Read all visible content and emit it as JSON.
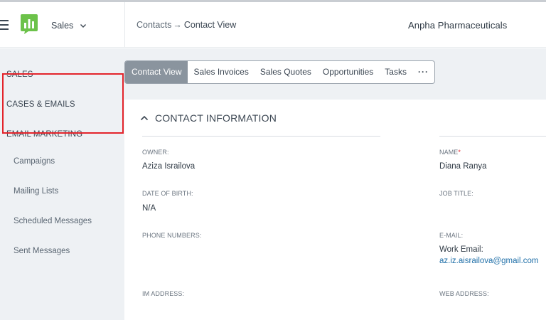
{
  "header": {
    "app_name": "Sales",
    "breadcrumb": {
      "parent": "Contacts",
      "arrow": "→",
      "current": "Contact View"
    },
    "company": "Anpha Pharmaceuticals"
  },
  "sidebar": {
    "sales": "SALES",
    "cases_emails": "CASES & EMAILS",
    "email_marketing": "EMAIL MARKETING",
    "campaigns": "Campaigns",
    "mailing_lists": "Mailing Lists",
    "scheduled_messages": "Scheduled Messages",
    "sent_messages": "Sent Messages"
  },
  "tabs": {
    "contact_view": "Contact View",
    "sales_invoices": "Sales Invoices",
    "sales_quotes": "Sales Quotes",
    "opportunities": "Opportunities",
    "tasks": "Tasks",
    "more": "···"
  },
  "contact": {
    "section_title": "CONTACT INFORMATION",
    "owner_label": "OWNER:",
    "owner_value": "Aziza Israilova",
    "name_label": "NAME",
    "required_mark": "*",
    "name_value": "Diana Ranya",
    "dob_label": "DATE OF BIRTH:",
    "dob_value": "N/A",
    "job_title_label": "JOB TITLE:",
    "phone_label": "PHONE NUMBERS:",
    "email_label": "E-MAIL:",
    "work_email_label": "Work Email:",
    "work_email_value": "az.iz.aisrailova@gmail.com",
    "im_label": "IM ADDRESS:",
    "web_label": "WEB ADDRESS:"
  },
  "colors": {
    "accent": "#1f6fa8",
    "highlight": "#e3242b",
    "logo_green": "#6cc24a",
    "active_tab": "#8a949e"
  }
}
